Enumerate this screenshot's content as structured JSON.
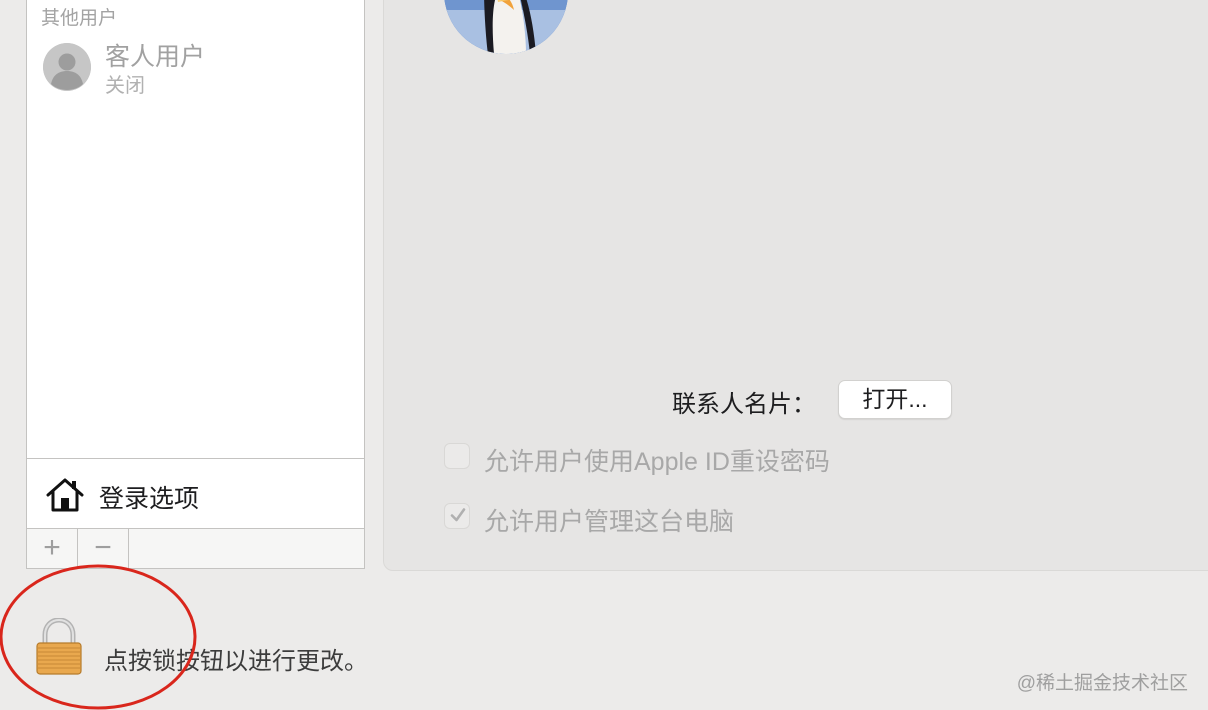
{
  "user_list": {
    "section_header": "其他用户",
    "guest_user": {
      "name": "客人用户",
      "status": "关闭"
    },
    "login_options_label": "登录选项",
    "toolbar": {
      "add_label": "+",
      "remove_label": "−"
    }
  },
  "details": {
    "contact_card_label": "联系人名片：",
    "open_button_label": "打开...",
    "options": [
      {
        "label": "允许用户使用Apple ID重设密码",
        "checked": false
      },
      {
        "label": "允许用户管理这台电脑",
        "checked": true
      }
    ]
  },
  "footer": {
    "lock_message": "点按锁按钮以进行更改。",
    "watermark": "@稀土掘金技术社区"
  },
  "colors": {
    "window_background": "#ecebea",
    "panel_background": "#e6e5e4",
    "annotation_red": "#d9261c"
  }
}
